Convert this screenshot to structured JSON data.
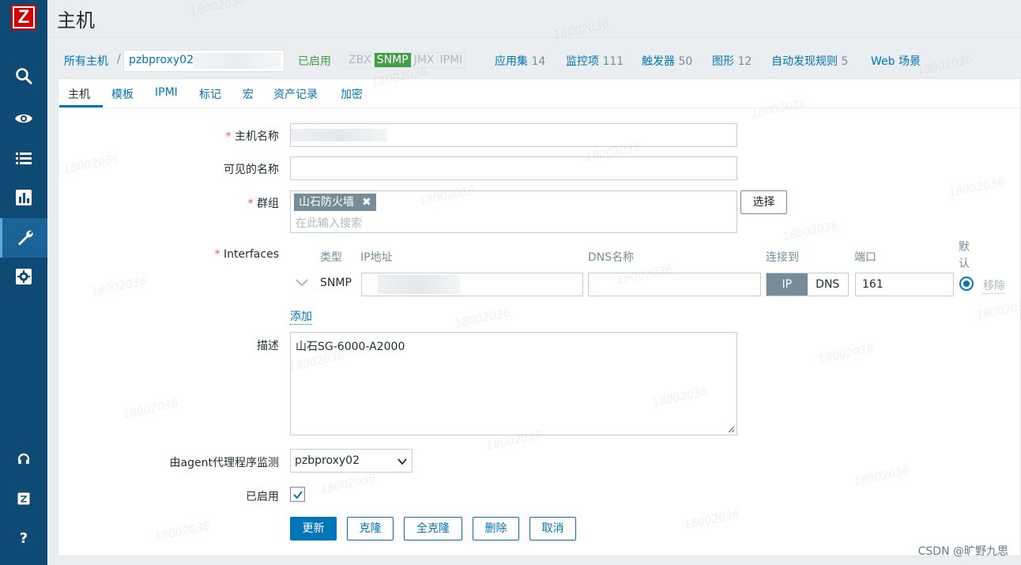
{
  "page": {
    "title": "主机"
  },
  "sidebar": {
    "logo_letter": "Z",
    "items": [
      {
        "icon": "search-icon"
      },
      {
        "icon": "eye-icon"
      },
      {
        "icon": "list-icon"
      },
      {
        "icon": "chart-icon"
      },
      {
        "icon": "wrench-icon"
      },
      {
        "icon": "gear-icon"
      }
    ],
    "bottom": [
      {
        "icon": "headset-icon"
      },
      {
        "icon": "zabbix-icon"
      },
      {
        "icon": "help-icon",
        "label": "?"
      }
    ]
  },
  "nav": {
    "all_hosts": "所有主机",
    "separator": "/",
    "host_name": "pzbproxy02",
    "status": "已启用",
    "availability": [
      "ZBX",
      "SNMP",
      "JMX",
      "IPMI"
    ],
    "apps_label": "应用集",
    "apps_count": "14",
    "items_label": "监控项",
    "items_count": "111",
    "triggers_label": "触发器",
    "triggers_count": "50",
    "graphs_label": "图形",
    "graphs_count": "12",
    "discovery_label": "自动发现规则",
    "discovery_count": "5",
    "web_label": "Web 场景"
  },
  "tabs": [
    "主机",
    "模板",
    "IPMI",
    "标记",
    "宏",
    "资产记录",
    "加密"
  ],
  "form": {
    "hostname_label": "主机名称",
    "visible_label": "可见的名称",
    "groups_label": "群组",
    "group_tag": "山石防火墙",
    "group_placeholder": "在此输入搜索",
    "select_button": "选择",
    "interfaces_label": "Interfaces",
    "iface_cols": {
      "type": "类型",
      "ip": "IP地址",
      "dns": "DNS名称",
      "connect": "连接到",
      "port": "端口",
      "default": "默认"
    },
    "iface_type": "SNMP",
    "iface_ip_btn": "IP",
    "iface_dns_btn": "DNS",
    "iface_port": "161",
    "iface_remove": "移除",
    "add_link": "添加",
    "desc_label": "描述",
    "desc_value": "山石SG-6000-A2000",
    "proxy_label": "由agent代理程序监测",
    "proxy_value": "pzbproxy02",
    "enabled_label": "已启用",
    "buttons": {
      "update": "更新",
      "clone": "克隆",
      "full_clone": "全克隆",
      "delete": "删除",
      "cancel": "取消"
    }
  },
  "watermark": "18002036",
  "credit": "CSDN @旷野九思"
}
